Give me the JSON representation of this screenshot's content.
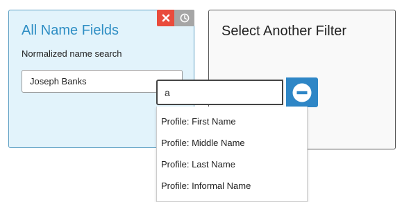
{
  "active_filter": {
    "title": "All Name Fields",
    "subtitle": "Normalized name search",
    "input_value": "Joseph Banks",
    "remove_icon": "close-icon",
    "history_icon": "clock-icon"
  },
  "new_filter": {
    "title": "Select Another Filter"
  },
  "search": {
    "value": "a",
    "clear_icon": "minus-circle-icon"
  },
  "options": [
    "Profile: First Name",
    "Profile: Middle Name",
    "Profile: Last Name",
    "Profile: Informal Name"
  ],
  "colors": {
    "accent": "#2e8ec4",
    "active_card_bg": "#e2f3fb",
    "remove_red": "#e94b3c",
    "history_gray": "#a6a6a6",
    "clear_blue": "#2e86c6"
  }
}
